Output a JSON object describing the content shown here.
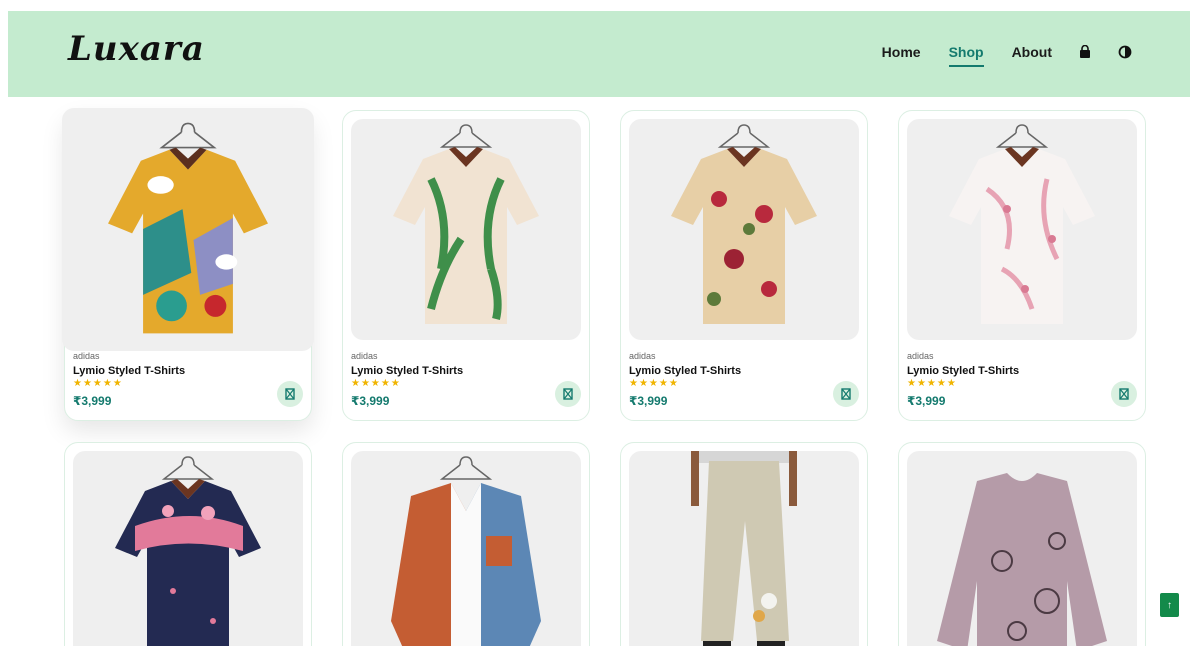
{
  "header": {
    "logo": "Luxara",
    "nav": [
      {
        "label": "Home",
        "active": false
      },
      {
        "label": "Shop",
        "active": true
      },
      {
        "label": "About",
        "active": false
      }
    ],
    "icons": [
      "shopping-bag-icon",
      "theme-toggle-icon"
    ]
  },
  "colors": {
    "header_bg": "#c4ebcf",
    "accent": "#147a6e",
    "star": "#f0b400",
    "scroll_top_bg": "#138a4a"
  },
  "products": [
    {
      "brand": "adidas",
      "title": "Lymio Styled T-Shirts",
      "stars": "★★★★★",
      "price": "₹3,999"
    },
    {
      "brand": "adidas",
      "title": "Lymio Styled T-Shirts",
      "stars": "★★★★★",
      "price": "₹3,999"
    },
    {
      "brand": "adidas",
      "title": "Lymio Styled T-Shirts",
      "stars": "★★★★★",
      "price": "₹3,999"
    },
    {
      "brand": "adidas",
      "title": "Lymio Styled T-Shirts",
      "stars": "★★★★★",
      "price": "₹3,999"
    },
    {
      "brand": "",
      "title": "",
      "stars": "",
      "price": ""
    },
    {
      "brand": "",
      "title": "",
      "stars": "",
      "price": ""
    },
    {
      "brand": "",
      "title": "",
      "stars": "",
      "price": ""
    },
    {
      "brand": "",
      "title": "",
      "stars": "",
      "price": ""
    }
  ],
  "scroll_top": {
    "label": "↑"
  }
}
